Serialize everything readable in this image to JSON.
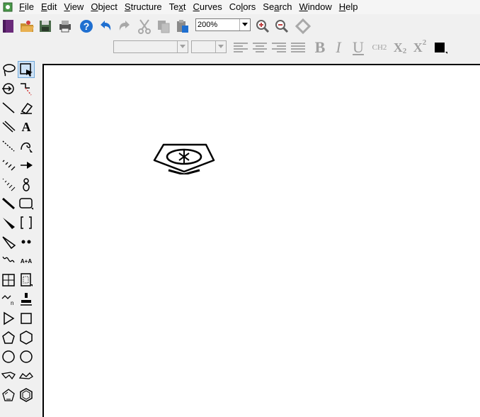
{
  "menu": {
    "items": [
      {
        "id": "file",
        "underline": "F",
        "rest": "ile"
      },
      {
        "id": "edit",
        "underline": "E",
        "rest": "dit"
      },
      {
        "id": "view",
        "underline": "V",
        "rest": "iew"
      },
      {
        "id": "object",
        "underline": "O",
        "rest": "bject"
      },
      {
        "id": "structure",
        "underline": "S",
        "rest": "tructure"
      },
      {
        "id": "text",
        "pre": "Te",
        "underline": "x",
        "rest": "t"
      },
      {
        "id": "curves",
        "underline": "C",
        "rest": "urves"
      },
      {
        "id": "colors",
        "pre": "Co",
        "underline": "l",
        "rest": "ors"
      },
      {
        "id": "search",
        "pre": "Se",
        "underline": "a",
        "rest": "rch"
      },
      {
        "id": "window",
        "underline": "W",
        "rest": "indow"
      },
      {
        "id": "help",
        "underline": "H",
        "rest": "elp"
      }
    ]
  },
  "toolbar": {
    "zoom_value": "200%"
  },
  "format": {
    "bold": "B",
    "italic": "I",
    "underline": "U",
    "ch2": "CH2",
    "subscript_base": "X",
    "subscript_digit": "2",
    "superscript_base": "X",
    "superscript_digit": "2"
  },
  "palette": {
    "text_tool_label": "A",
    "map_tool_label": "A+A"
  },
  "colors": {
    "accent_blue": "#1f6fd0",
    "canvas": "#ffffff",
    "menubar": "#f5f5f5"
  }
}
